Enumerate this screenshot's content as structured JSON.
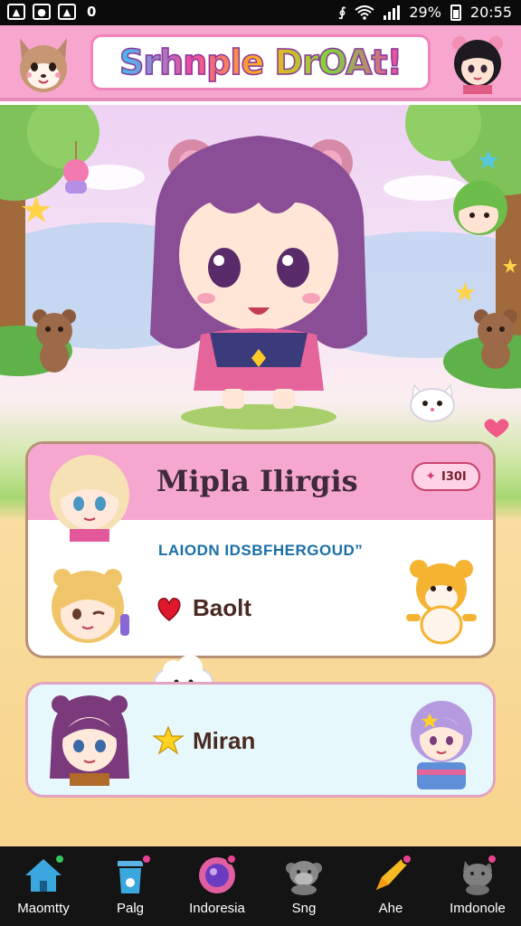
{
  "status_bar": {
    "left_icons": [
      "notification-icon",
      "notification-icon",
      "gallery-icon"
    ],
    "extra_indicator": "0",
    "battery": "29%",
    "time": "20:55"
  },
  "header": {
    "title": "Srhnple DrOAt!"
  },
  "card_one": {
    "name": "Mipla Ilirgis",
    "badge_label": "I30I",
    "subtitle": "LAIODN IDSBFHERGOUD”",
    "item_label": "Baolt"
  },
  "card_two": {
    "item_label": "Miran"
  },
  "bottom_nav": {
    "items": [
      {
        "label": "Maomtty",
        "icon": "home-icon",
        "dot": "#34c759"
      },
      {
        "label": "Palg",
        "icon": "trash-icon",
        "dot": "#e84393"
      },
      {
        "label": "Indoresia",
        "icon": "orb-icon",
        "dot": "#e84393"
      },
      {
        "label": "Sng",
        "icon": "gorilla-icon",
        "dot": null
      },
      {
        "label": "Ahe",
        "icon": "pen-icon",
        "dot": "#e84393"
      },
      {
        "label": "Imdonole",
        "icon": "pet-icon",
        "dot": "#e84393"
      }
    ]
  },
  "colors": {
    "header_pink": "#f7a7cd",
    "accent_pink": "#e84393",
    "subtitle_blue": "#1a70a6",
    "nav_bg": "#141414"
  }
}
